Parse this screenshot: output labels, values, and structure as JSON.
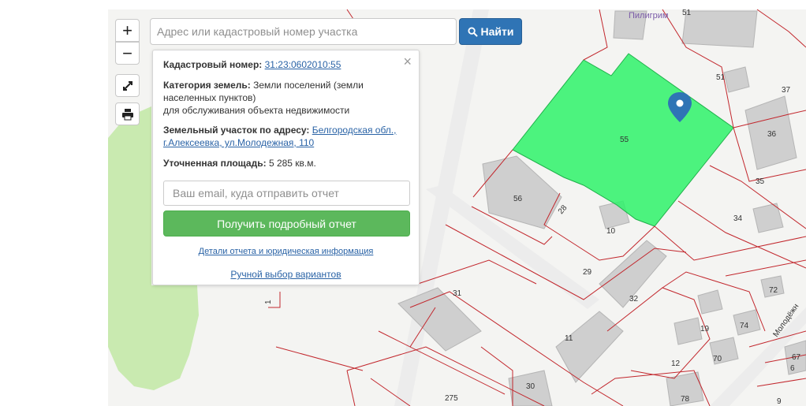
{
  "search": {
    "placeholder": "Адрес или кадастровый номер участка",
    "button_label": "Найти"
  },
  "controls": {
    "zoom_in": "+",
    "zoom_out": "−"
  },
  "popup": {
    "close": "×",
    "cadastral_label": "Кадастровый номер:",
    "cadastral_value": "31:23:0602010:55",
    "category_label": "Категория земель:",
    "category_value_1": "Земли поселений (земли",
    "category_value_2": "населенных пунктов)",
    "category_value_3": "для обслуживания объекта недвижимости",
    "address_label": "Земельный участок по адресу:",
    "address_value_1": "Белгородская обл.,",
    "address_value_2": "г.Алексеевка, ул.Молодежная, 110",
    "area_label": "Уточненная площадь:",
    "area_value": "5 285 кв.м.",
    "email_placeholder": "Ваш email, куда отправить отчет",
    "report_button": "Получить подробный отчет",
    "details_link": "Детали отчета и юридическая информация",
    "manual_link": "Ручной выбор вариантов"
  },
  "map": {
    "street_label_top": "Пилигрим",
    "street_label_right": "Молодёжн",
    "parcel_numbers": [
      "51",
      "51",
      "37",
      "55",
      "36",
      "35",
      "56",
      "28",
      "10",
      "34",
      "29",
      "31",
      "32",
      "72",
      "19",
      "74",
      "11",
      "12",
      "70",
      "67",
      "275",
      "30",
      "78",
      "6",
      "9",
      "1"
    ],
    "colors": {
      "highlight": "#2ef26a",
      "parcel_line": "#c2272d",
      "green_area": "#c9eab0",
      "building": "#cfcfcf",
      "marker": "#2f74b5"
    }
  }
}
